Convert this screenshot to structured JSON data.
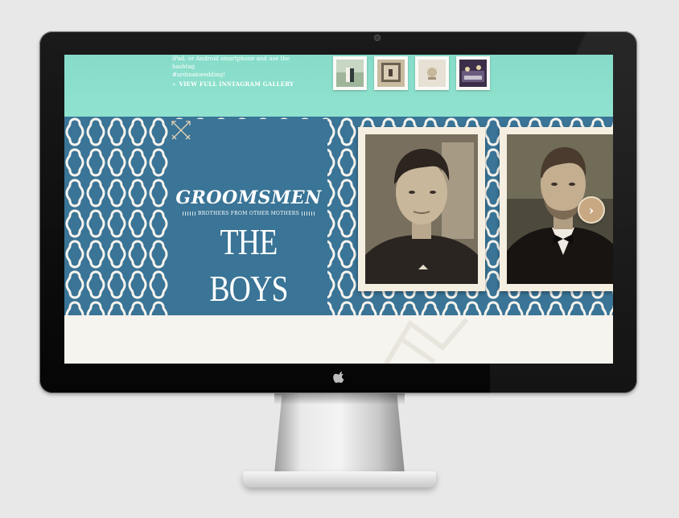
{
  "instagram": {
    "text_lines": [
      "iPad, or Android smartphone and use the hashtag",
      "#ardmakwedding!"
    ],
    "gallery_link": "VIEW FULL INSTAGRAM GALLERY",
    "thumbnails": [
      "instagram-photo-1",
      "instagram-photo-2",
      "instagram-photo-3",
      "instagram-photo-4"
    ]
  },
  "groomsmen": {
    "heading": "GROOMSMEN",
    "subtitle": "BROTHERS FROM OTHER MOTHERS",
    "title": "THE BOYS",
    "icon": "crossed-arrows-icon",
    "next_icon": "chevron-right-icon"
  },
  "colors": {
    "teal": "#8fe2cf",
    "blue": "#3a7496",
    "frame": "#f5efe2",
    "button": "#c8a882",
    "paper": "#f6f4ee"
  }
}
